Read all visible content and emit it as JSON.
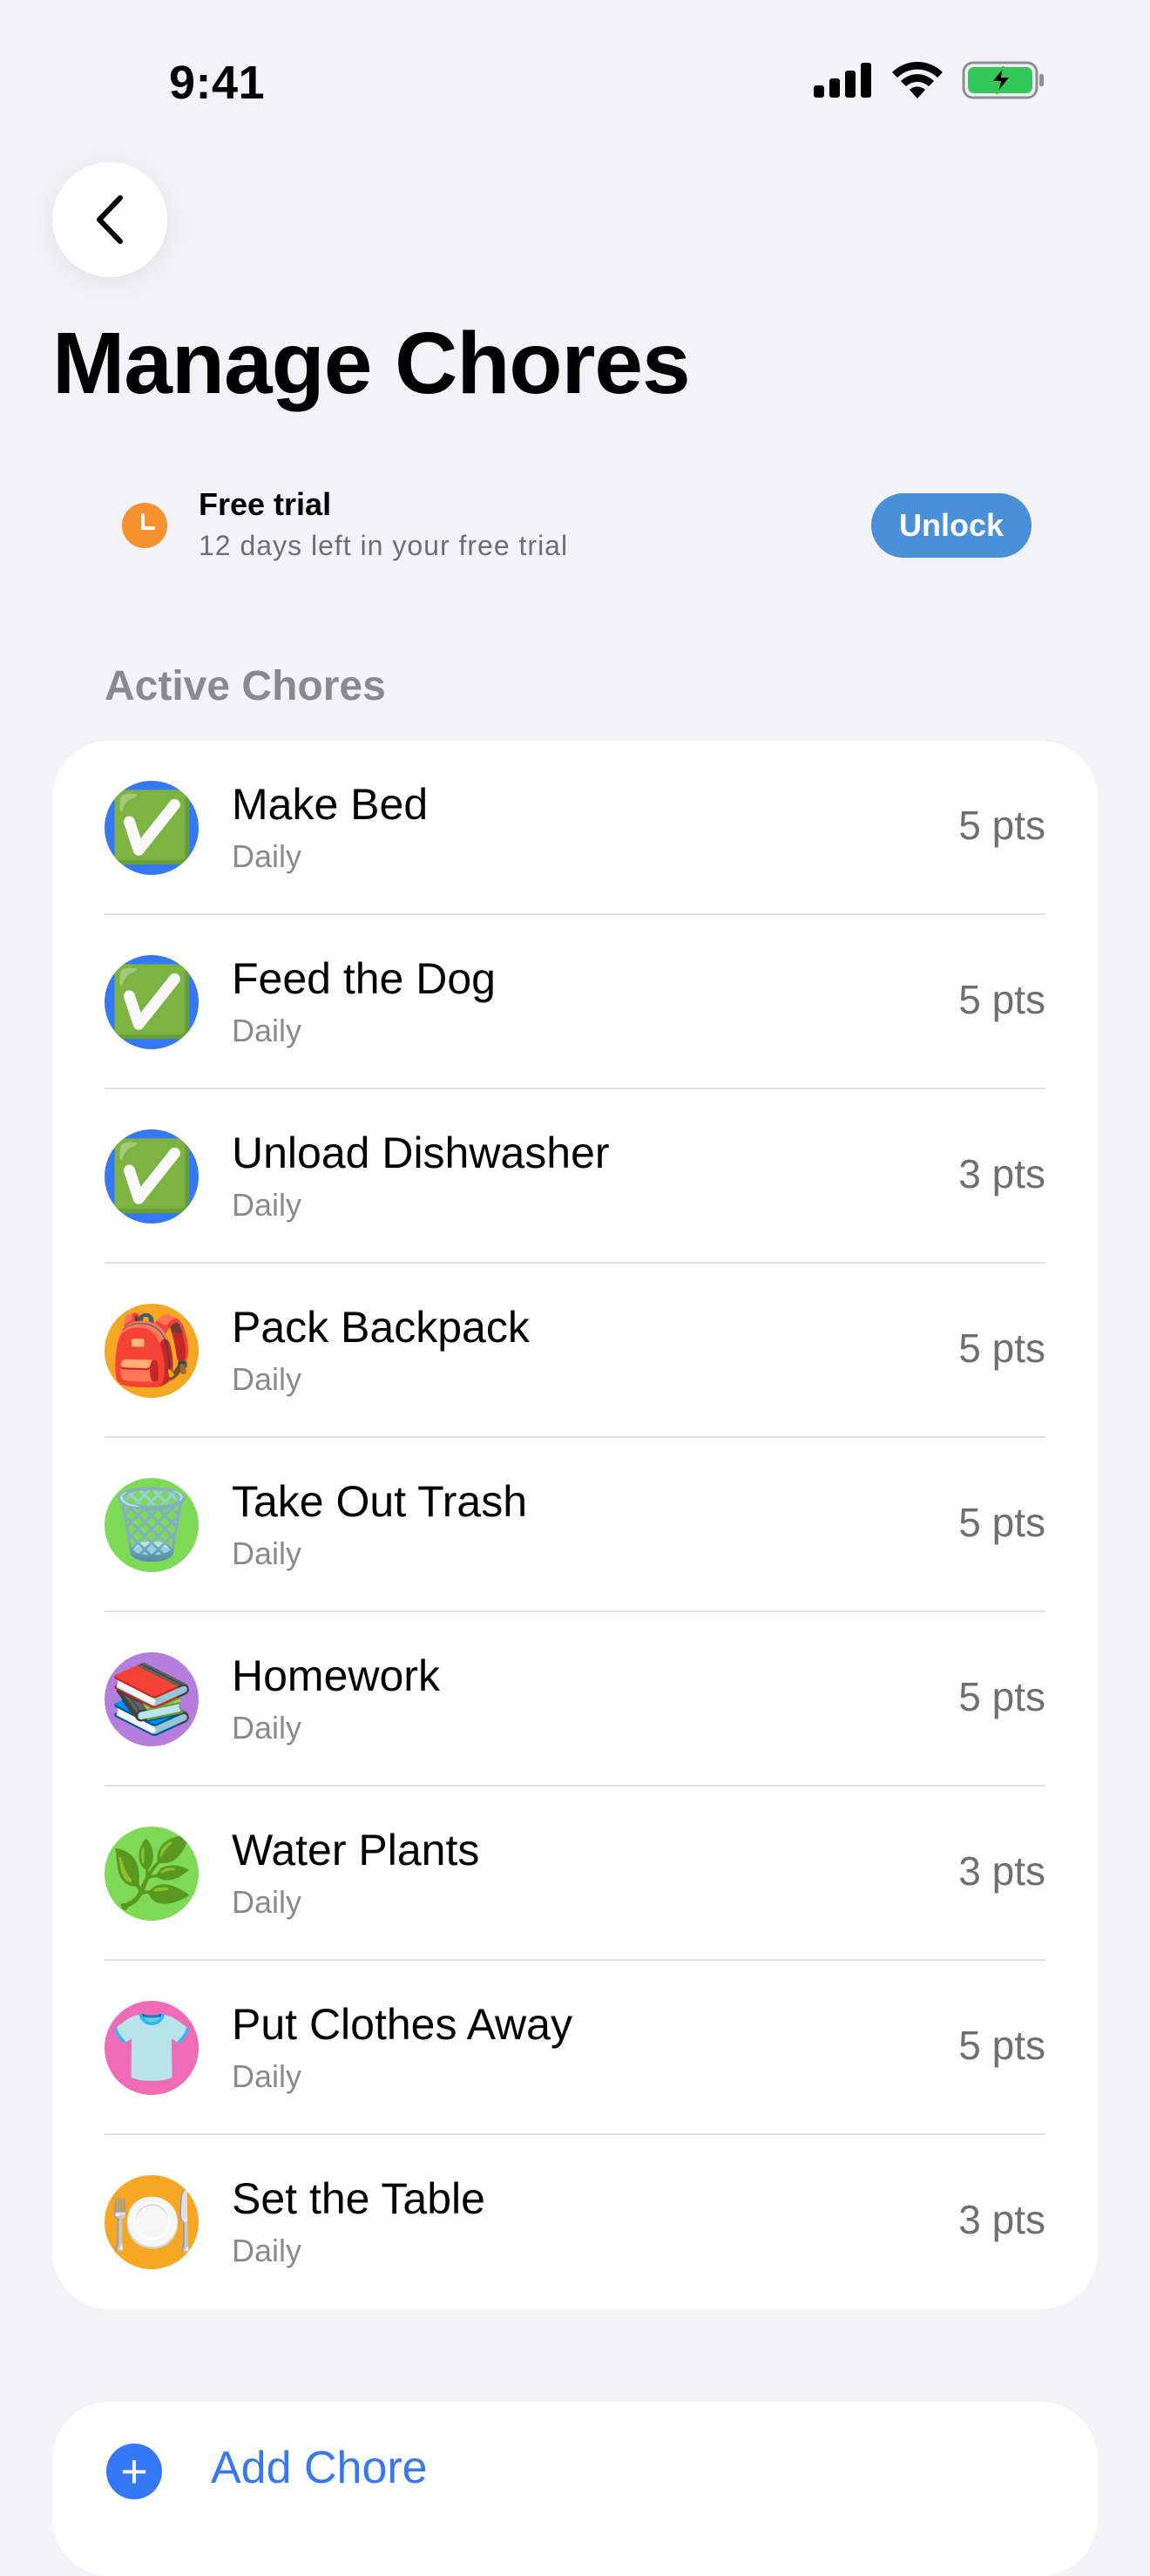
{
  "status_bar": {
    "time": "9:41",
    "icons": [
      "cellular-signal-icon",
      "wifi-icon",
      "battery-charging-icon"
    ]
  },
  "header": {
    "back_icon": "chevron-left-icon",
    "title": "Manage Chores"
  },
  "trial": {
    "icon": "clock-icon",
    "title": "Free trial",
    "subtitle": "12 days left in your free trial",
    "button_label": "Unlock",
    "accent_color": "#F5922F",
    "button_color": "#4A90D9"
  },
  "section": {
    "label": "Active Chores"
  },
  "chores": [
    {
      "name": "Make Bed",
      "frequency": "Daily",
      "points": "5 pts",
      "icon": "check-mark-button-icon",
      "glyph": "✅",
      "bg": "#3478F6"
    },
    {
      "name": "Feed the Dog",
      "frequency": "Daily",
      "points": "5 pts",
      "icon": "check-mark-button-icon",
      "glyph": "✅",
      "bg": "#3478F6"
    },
    {
      "name": "Unload Dishwasher",
      "frequency": "Daily",
      "points": "3 pts",
      "icon": "check-mark-button-icon",
      "glyph": "✅",
      "bg": "#3478F6"
    },
    {
      "name": "Pack Backpack",
      "frequency": "Daily",
      "points": "5 pts",
      "icon": "backpack-icon",
      "glyph": "🎒",
      "bg": "#F5A623"
    },
    {
      "name": "Take Out Trash",
      "frequency": "Daily",
      "points": "5 pts",
      "icon": "wastebasket-icon",
      "glyph": "🗑️",
      "bg": "#7ED957"
    },
    {
      "name": "Homework",
      "frequency": "Daily",
      "points": "5 pts",
      "icon": "books-icon",
      "glyph": "📚",
      "bg": "#B57EDC"
    },
    {
      "name": "Water Plants",
      "frequency": "Daily",
      "points": "3 pts",
      "icon": "herb-icon",
      "glyph": "🌿",
      "bg": "#7ED957"
    },
    {
      "name": "Put Clothes Away",
      "frequency": "Daily",
      "points": "5 pts",
      "icon": "shirt-icon",
      "glyph": "👕",
      "bg": "#F06BB6"
    },
    {
      "name": "Set the Table",
      "frequency": "Daily",
      "points": "3 pts",
      "icon": "fork-knife-plate-icon",
      "glyph": "🍽️",
      "bg": "#F5A623"
    }
  ],
  "add_chore": {
    "icon": "plus-circle-icon",
    "label": "Add Chore",
    "color": "#3478F6"
  }
}
